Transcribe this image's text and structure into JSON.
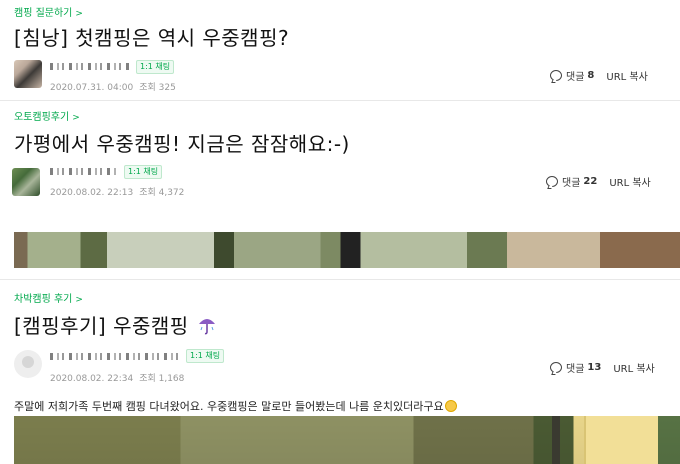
{
  "posts": [
    {
      "category": "캠핑 질문하기",
      "title": "[침낭] 첫캠핑은 역시 우중캠핑?",
      "chat_badge": "1:1 채팅",
      "date": "2020.07.31. 04:00",
      "views": "조회 325",
      "comment_label": "댓글",
      "comment_count": "8",
      "url_copy": "URL 복사"
    },
    {
      "category": "오토캠핑후기",
      "title": "가평에서 우중캠핑! 지금은 잠잠해요:-)",
      "chat_badge": "1:1 채팅",
      "date": "2020.08.02. 22:13",
      "views": "조회 4,372",
      "comment_label": "댓글",
      "comment_count": "22",
      "url_copy": "URL 복사"
    },
    {
      "category": "차박캠핑 후기",
      "title": "[캠핑후기] 우중캠핑",
      "chat_badge": "1:1 채팅",
      "date": "2020.08.02. 22:34",
      "views": "조회 1,168",
      "comment_label": "댓글",
      "comment_count": "13",
      "url_copy": "URL 복사",
      "body": "주말에 저희가족 두번째 캠핑 다녀왔어요. 우중캠핑은 말로만 들어봤는데 나름 운치있더라구요"
    }
  ],
  "colors": {
    "accent": "#03a94d",
    "meta": "#999999"
  },
  "icons": [
    "chevron-right-icon",
    "comment-icon",
    "umbrella-icon",
    "smile-emoji-icon"
  ]
}
